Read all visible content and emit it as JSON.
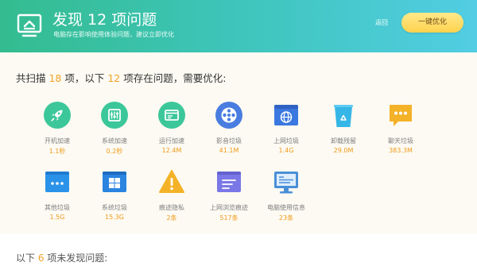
{
  "header": {
    "title": "发现 12 项问题",
    "subtitle": "电脑存在影响使用体验问题，建议立即优化",
    "back_label": "返回",
    "optimize_label": "一键优化"
  },
  "summary": {
    "prefix": "共扫描 ",
    "scanned": "18",
    "middle": " 项，以下 ",
    "problems": "12",
    "suffix": " 项存在问题，需要优化:"
  },
  "items": [
    {
      "name": "开机加速",
      "value": "1.1秒",
      "icon": "rocket-icon",
      "color": "#3cc79a"
    },
    {
      "name": "系统加速",
      "value": "0.2秒",
      "icon": "equalizer-icon",
      "color": "#3cc79a"
    },
    {
      "name": "运行加速",
      "value": "12.4M",
      "icon": "window-icon",
      "color": "#3cc79a"
    },
    {
      "name": "影音垃圾",
      "value": "41.1M",
      "icon": "film-reel-icon",
      "color": "#4a7de0"
    },
    {
      "name": "上网垃圾",
      "value": "1.4G",
      "icon": "globe-browser-icon",
      "color": "#3b78e0"
    },
    {
      "name": "卸载残留",
      "value": "29.0M",
      "icon": "recycle-bin-icon",
      "color": "#35b6e6"
    },
    {
      "name": "聊天垃圾",
      "value": "383.3M",
      "icon": "chat-bubble-icon",
      "color": "#f4b228"
    },
    {
      "name": "其他垃圾",
      "value": "1.5G",
      "icon": "more-window-icon",
      "color": "#2a93e9"
    },
    {
      "name": "系统垃圾",
      "value": "15.3G",
      "icon": "windows-logo-icon",
      "color": "#2a84e0"
    },
    {
      "name": "痕迹隐私",
      "value": "2条",
      "icon": "warning-triangle-icon",
      "color": "#f4b228"
    },
    {
      "name": "上网浏览痕迹",
      "value": "517条",
      "icon": "history-list-icon",
      "color": "#7a78e6"
    },
    {
      "name": "电脑使用信息",
      "value": "23条",
      "icon": "monitor-info-icon",
      "color": "#4a8fd8"
    }
  ],
  "not_found": {
    "prefix": "以下 ",
    "count": "6",
    "suffix": " 项未发现问题:"
  },
  "colors": {
    "header_start": "#34bc8f",
    "header_end": "#52cde3",
    "accent_number": "#f1a326",
    "button": "#ffd24e"
  }
}
